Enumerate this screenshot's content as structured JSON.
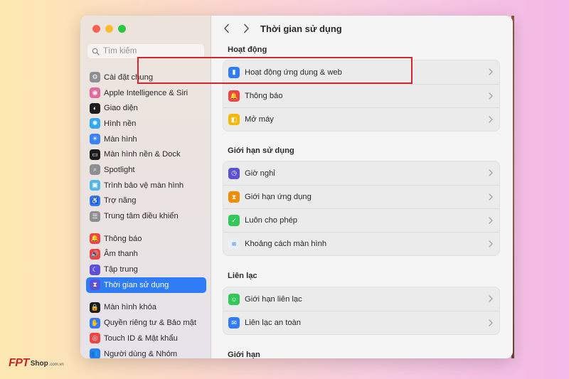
{
  "window": {
    "title": "Thời gian sử dụng"
  },
  "search": {
    "placeholder": "Tìm kiếm"
  },
  "sidebar": {
    "groups": [
      [
        {
          "label": "Cài đặt chung",
          "icon": "gear-icon",
          "color": "#8e8e93"
        },
        {
          "label": "Apple Intelligence & Siri",
          "icon": "siri-icon",
          "color": "#e06a9e"
        },
        {
          "label": "Giao diện",
          "icon": "appearance-icon",
          "color": "#1c1c1e"
        },
        {
          "label": "Hình nền",
          "icon": "wallpaper-icon",
          "color": "#35a8f0"
        },
        {
          "label": "Màn hình",
          "icon": "display-icon",
          "color": "#3b82f6"
        },
        {
          "label": "Màn hình nền & Dock",
          "icon": "dock-icon",
          "color": "#1c1c1e"
        },
        {
          "label": "Spotlight",
          "icon": "spotlight-icon",
          "color": "#8e8e93"
        },
        {
          "label": "Trình bảo vệ màn hình",
          "icon": "screensaver-icon",
          "color": "#4fb8e8"
        },
        {
          "label": "Trợ năng",
          "icon": "accessibility-icon",
          "color": "#2f7cf6"
        },
        {
          "label": "Trung tâm điều khiển",
          "icon": "control-center-icon",
          "color": "#8e8e93"
        }
      ],
      [
        {
          "label": "Thông báo",
          "icon": "notification-icon",
          "color": "#ef4444"
        },
        {
          "label": "Âm thanh",
          "icon": "sound-icon",
          "color": "#ef4444"
        },
        {
          "label": "Tập trung",
          "icon": "focus-icon",
          "color": "#5b50d6"
        },
        {
          "label": "Thời gian sử dụng",
          "icon": "hourglass-icon",
          "color": "#5b50d6",
          "active": true
        }
      ],
      [
        {
          "label": "Màn hình khóa",
          "icon": "lock-screen-icon",
          "color": "#1c1c1e"
        },
        {
          "label": "Quyền riêng tư & Bảo mật",
          "icon": "privacy-hand-icon",
          "color": "#2f7cf6"
        },
        {
          "label": "Touch ID & Mật khẩu",
          "icon": "fingerprint-icon",
          "color": "#ef4444"
        },
        {
          "label": "Người dùng & Nhóm",
          "icon": "users-icon",
          "color": "#2f7cf6"
        }
      ]
    ]
  },
  "sections": [
    {
      "heading": "Hoạt động",
      "rows": [
        {
          "label": "Hoạt động ứng dụng & web",
          "icon": "app-activity-icon",
          "color": "#2f7cf6"
        },
        {
          "label": "Thông báo",
          "icon": "notification-icon",
          "color": "#ef4444"
        },
        {
          "label": "Mở máy",
          "icon": "pickups-icon",
          "color": "#f5b800"
        }
      ]
    },
    {
      "heading": "Giới hạn sử dụng",
      "rows": [
        {
          "label": "Giờ nghỉ",
          "icon": "downtime-icon",
          "color": "#5b50d6"
        },
        {
          "label": "Giới hạn ứng dụng",
          "icon": "hourglass-icon",
          "color": "#f08c00"
        },
        {
          "label": "Luôn cho phép",
          "icon": "always-allowed-icon",
          "color": "#34c759"
        },
        {
          "label": "Khoảng cách màn hình",
          "icon": "screen-distance-icon",
          "color": "#e8f0fb"
        }
      ]
    },
    {
      "heading": "Liên lạc",
      "rows": [
        {
          "label": "Giới hạn liên lạc",
          "icon": "communication-limits-icon",
          "color": "#34c759"
        },
        {
          "label": "Liên lạc an toàn",
          "icon": "communication-safety-icon",
          "color": "#2f7cf6"
        }
      ]
    },
    {
      "heading": "Giới hạn",
      "rows": []
    }
  ],
  "colors": {
    "accent": "#2f7cf6",
    "highlight_box": "#d6262b"
  },
  "watermark": {
    "brand": "FPT",
    "shop": "Shop",
    "domain": ".com.vn"
  }
}
